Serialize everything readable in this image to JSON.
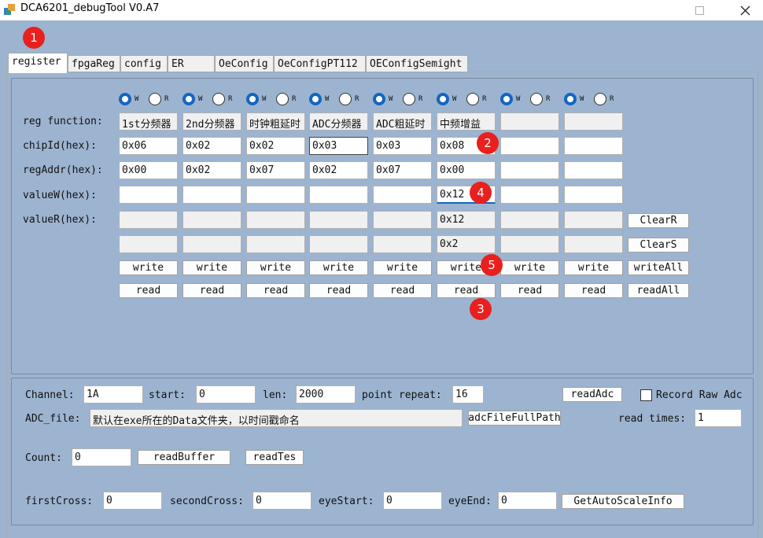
{
  "window": {
    "title": "DCA6201_debugTool V0.A7"
  },
  "tabs": [
    {
      "label": "register"
    },
    {
      "label": "fpgaReg"
    },
    {
      "label": "config"
    },
    {
      "label": "ER"
    },
    {
      "label": "OeConfig"
    },
    {
      "label": "OeConfigPT112"
    },
    {
      "label": "OEConfigSemight"
    }
  ],
  "markers": [
    "1",
    "2",
    "3",
    "4",
    "5"
  ],
  "reg": {
    "radio_w": "W",
    "radio_r": "R",
    "row_labels": {
      "function": "reg function:",
      "chipId": "chipId(hex):",
      "regAddr": "regAddr(hex):",
      "valueW": "valueW(hex):",
      "valueR": "valueR(hex):"
    },
    "columns": [
      {
        "function": "1st分频器",
        "chipId": "0x06",
        "regAddr": "0x00",
        "valueW": "",
        "valueR": "",
        "valueS": ""
      },
      {
        "function": "2nd分频器",
        "chipId": "0x02",
        "regAddr": "0x02",
        "valueW": "",
        "valueR": "",
        "valueS": ""
      },
      {
        "function": "时钟粗延时",
        "chipId": "0x02",
        "regAddr": "0x07",
        "valueW": "",
        "valueR": "",
        "valueS": ""
      },
      {
        "function": "ADC分频器",
        "chipId": "0x03",
        "regAddr": "0x02",
        "valueW": "",
        "valueR": "",
        "valueS": ""
      },
      {
        "function": "ADC粗延时",
        "chipId": "0x03",
        "regAddr": "0x07",
        "valueW": "",
        "valueR": "",
        "valueS": ""
      },
      {
        "function": "中频增益",
        "chipId": "0x08",
        "regAddr": "0x00",
        "valueW": "0x12",
        "valueR": "0x12",
        "valueS": "0x2"
      },
      {
        "function": "",
        "chipId": "",
        "regAddr": "",
        "valueW": "",
        "valueR": "",
        "valueS": ""
      },
      {
        "function": "",
        "chipId": "",
        "regAddr": "",
        "valueW": "",
        "valueR": "",
        "valueS": ""
      }
    ],
    "write_label": "write",
    "read_label": "read",
    "clearR": "ClearR",
    "clearS": "ClearS",
    "writeAll": "writeAll",
    "readAll": "readAll"
  },
  "adc": {
    "channel_label": "Channel:",
    "channel_value": "1A",
    "start_label": "start:",
    "start_value": "0",
    "len_label": "len:",
    "len_value": "2000",
    "repeat_label": "point repeat:",
    "repeat_value": "16",
    "readAdc": "readAdc",
    "record_label": "Record Raw Adc",
    "file_label": "ADC_file:",
    "file_value": "默认在exe所在的Data文件夹，以时间戳命名",
    "fullpath": "adcFileFullPath",
    "times_label": "read times:",
    "times_value": "1",
    "count_label": "Count:",
    "count_value": "0",
    "readBuffer": "readBuffer",
    "readTes": "readTes",
    "firstCross_label": "firstCross:",
    "firstCross_value": "0",
    "secondCross_label": "secondCross:",
    "secondCross_value": "0",
    "eyeStart_label": "eyeStart:",
    "eyeStart_value": "0",
    "eyeEnd_label": "eyeEnd:",
    "eyeEnd_value": "0",
    "getAuto": "GetAutoScaleInfo"
  }
}
